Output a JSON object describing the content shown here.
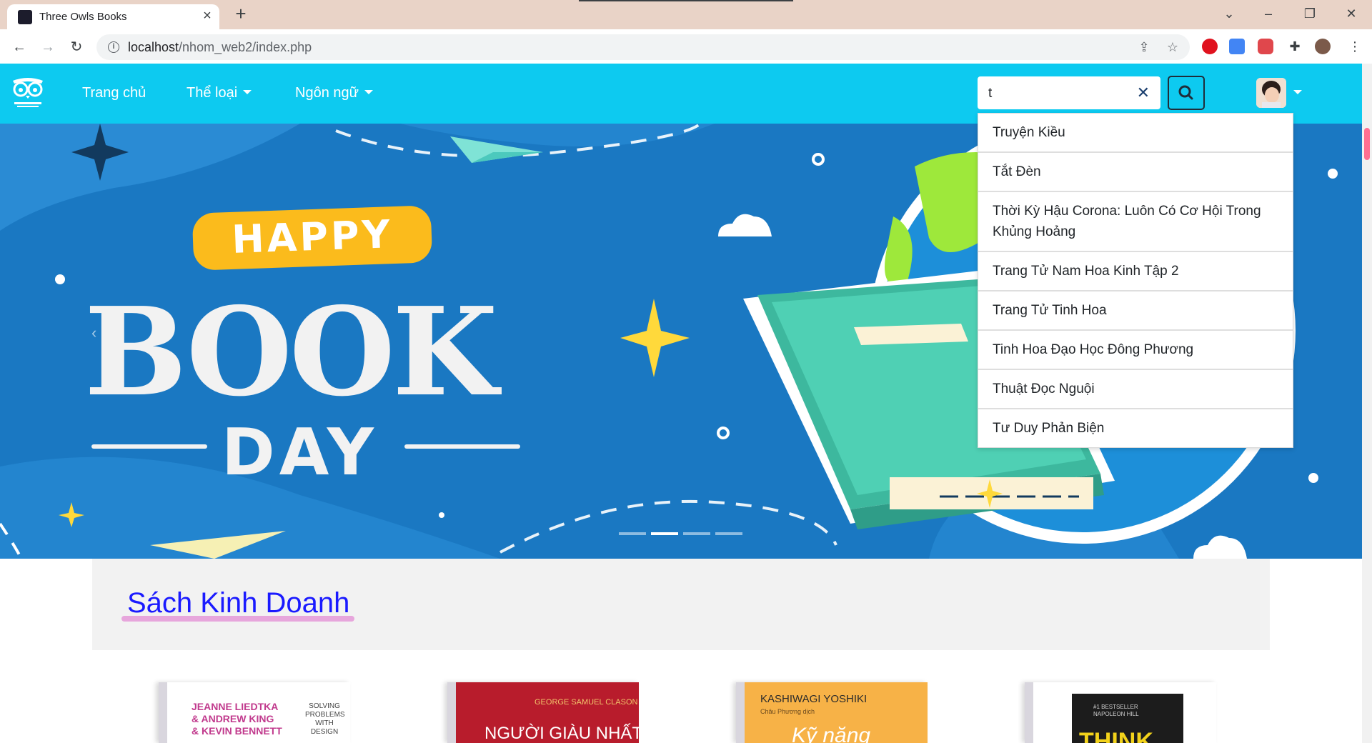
{
  "browser": {
    "tab_title": "Three Owls Books",
    "url_host": "localhost",
    "url_path": "/nhom_web2/index.php"
  },
  "nav": {
    "home": "Trang chủ",
    "genre": "Thể loại",
    "language": "Ngôn ngữ"
  },
  "search": {
    "value": "t",
    "clear": "✕"
  },
  "suggestions": [
    "Truyện Kiều",
    "Tắt Đèn",
    "Thời Kỳ Hậu Corona: Luôn Có Cơ Hội Trong Khủng Hoảng",
    "Trang Tử Nam Hoa Kinh Tập 2",
    "Trang Tử Tinh Hoa",
    "Tinh Hoa Đạo Học Đông Phương",
    "Thuật Đọc Nguội",
    "Tư Duy Phản Biện"
  ],
  "hero": {
    "happy": "HAPPY",
    "book": "BOOK",
    "day": "DAY",
    "active_slide": 2,
    "slide_count": 4
  },
  "section": {
    "title": "Sách Kinh Doanh"
  },
  "books": [
    {
      "line1": "JEANNE LIEDTKA",
      "line2": "& ANDREW KING",
      "line3": "& KEVIN BENNETT",
      "side1": "SOLVING",
      "side2": "PROBLEMS",
      "side3": "WITH",
      "side4": "DESIGN"
    },
    {
      "author": "GEORGE SAMUEL CLASON",
      "title": "NGƯỜI GIÀU NHẤT"
    },
    {
      "author": "KASHIWAGI YOSHIKI",
      "translator": "Châu Phương dịch",
      "title": "Kỹ năng"
    },
    {
      "badge": "#1 BESTSELLER",
      "author": "NAPOLEON HILL",
      "title": "THINK"
    }
  ],
  "colors": {
    "navbar": "#0dcaf0",
    "hero_bg": "#1a78c2",
    "accent_yellow": "#fbbb1c",
    "section_title": "#1a1aff"
  }
}
